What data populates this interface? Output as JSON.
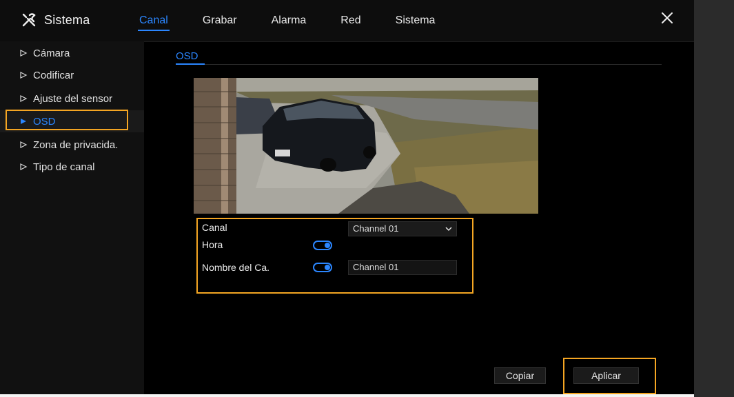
{
  "header": {
    "title": "Sistema",
    "icon": "tools-icon",
    "tabs": [
      {
        "label": "Canal",
        "active": true
      },
      {
        "label": "Grabar",
        "active": false
      },
      {
        "label": "Alarma",
        "active": false
      },
      {
        "label": "Red",
        "active": false
      },
      {
        "label": "Sistema",
        "active": false
      }
    ]
  },
  "sidebar": {
    "items": [
      {
        "label": "Cámara",
        "active": false
      },
      {
        "label": "Codificar",
        "active": false
      },
      {
        "label": "Ajuste del sensor",
        "active": false
      },
      {
        "label": "OSD",
        "active": true
      },
      {
        "label": "Zona de privacida.",
        "active": false
      },
      {
        "label": "Tipo de canal",
        "active": false
      }
    ]
  },
  "main": {
    "subtab": "OSD",
    "form": {
      "canal_label": "Canal",
      "canal_value": "Channel 01",
      "hora_label": "Hora",
      "hora_enabled": true,
      "nombre_label": "Nombre del Ca.",
      "nombre_enabled": true,
      "nombre_value": "Channel 01"
    },
    "buttons": {
      "copy": "Copiar",
      "apply": "Aplicar"
    }
  },
  "colors": {
    "accent": "#2b86ff",
    "highlight": "#f5a623",
    "background": "#000000"
  }
}
